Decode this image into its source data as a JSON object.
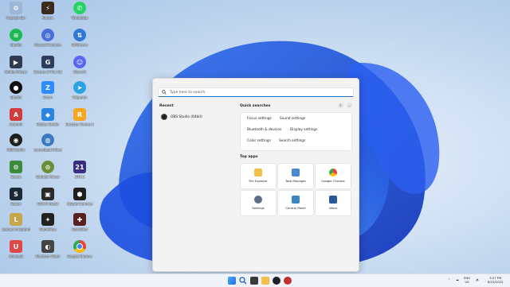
{
  "desktop": {
    "icons": [
      {
        "label": "Recycle Bin",
        "icon": "recycle-bin-icon",
        "color": "#9db6d6"
      },
      {
        "label": "Spotify",
        "icon": "spotify-icon",
        "color": "#1db954"
      },
      {
        "label": "Golden Player",
        "icon": "golden-player-icon",
        "color": "#2f3b4f"
      },
      {
        "label": "Spotify",
        "icon": "spotify-icon",
        "color": "#1db954"
      },
      {
        "label": "Android",
        "icon": "android-icon",
        "color": "#d13c3c"
      },
      {
        "label": "OBS Studio",
        "icon": "obs-icon",
        "color": "#1e1e1e"
      },
      {
        "label": "Steam",
        "icon": "steam-icon",
        "color": "#1b2838"
      },
      {
        "label": "Steam",
        "icon": "steam-icon",
        "color": "#1b2838"
      },
      {
        "label": "League of Legends",
        "icon": "lol-icon",
        "color": "#c8a64b"
      },
      {
        "label": "Uninstall",
        "icon": "uninstall-icon",
        "color": "#e04848"
      },
      {
        "label": "Kinetic",
        "icon": "kinetic-icon",
        "color": "#3b2b1e"
      },
      {
        "label": "Discord Connect",
        "icon": "discord-connect-icon",
        "color": "#4a6fd8"
      },
      {
        "label": "Garena of The Gamer",
        "icon": "garena-icon",
        "color": "#2e3d5c"
      },
      {
        "label": "Zoom",
        "icon": "zoom-icon",
        "color": "#2d8cff"
      },
      {
        "label": "Roblox Studio",
        "icon": "roblox-studio-icon",
        "color": "#2a86e0"
      },
      {
        "label": "Launchpad (Tiles)",
        "icon": "launchpad-icon",
        "color": "#3c7bbf"
      },
      {
        "label": "Outlook Mover",
        "icon": "outlook-mover-icon",
        "color": "#6b8f3a"
      },
      {
        "label": "GTA IV Install",
        "icon": "gta-icon",
        "color": "#2a2a2a"
      },
      {
        "label": "GamePrep",
        "icon": "gameprep-icon",
        "color": "#222222"
      },
      {
        "label": "Rockstar Client",
        "icon": "rockstar-icon",
        "color": "#444444"
      },
      {
        "label": "WhatsApp",
        "icon": "whatsapp-icon",
        "color": "#25d366"
      },
      {
        "label": "BitTorrent",
        "icon": "bittorrent-icon",
        "color": "#2f77d1"
      },
      {
        "label": "Discord",
        "icon": "discord-icon",
        "color": "#5865f2"
      },
      {
        "label": "Telegram",
        "icon": "telegram-icon",
        "color": "#2aa3e0"
      },
      {
        "label": "Rockstar Games Launcher",
        "icon": "rockstar-games-icon",
        "color": "#f5a623"
      },
      {
        "label": "GTA 5",
        "icon": "gta5-icon",
        "color": "#3b2d82"
      },
      {
        "label": "Ubisoft Connect",
        "icon": "ubisoft-icon",
        "color": "#1f1f1f"
      },
      {
        "label": "GameTest",
        "icon": "gametest-icon",
        "color": "#5a1f1f"
      },
      {
        "label": "Google Chrome",
        "icon": "chrome-icon",
        "color": "#fbbc05"
      }
    ]
  },
  "search": {
    "placeholder": "Type here to search"
  },
  "recent": {
    "heading": "Recent",
    "items": [
      {
        "label": "OBS Studio (64bit)",
        "icon": "obs-icon"
      }
    ]
  },
  "quick_searches": {
    "heading": "Quick searches",
    "items": [
      "Focus settings",
      "Sound settings",
      "Bluetooth & devices",
      "Display settings",
      "Color settings",
      "Search settings"
    ],
    "buttons": [
      "F",
      "..."
    ]
  },
  "top_apps": {
    "heading": "Top apps",
    "items": [
      {
        "label": "File Explorer",
        "icon": "folder-icon",
        "color": "#f2c04a"
      },
      {
        "label": "Task Manager",
        "icon": "task-manager-icon",
        "color": "#4a8ad1"
      },
      {
        "label": "Google Chrome",
        "icon": "chrome-icon",
        "color": "#e84335"
      },
      {
        "label": "Settings",
        "icon": "gear-icon",
        "color": "#5a6f8a"
      },
      {
        "label": "Control Panel",
        "icon": "control-panel-icon",
        "color": "#3d86c6"
      },
      {
        "label": "Word",
        "icon": "word-icon",
        "color": "#2b579a"
      }
    ]
  },
  "taskbar": {
    "time": "3:27 PM",
    "date": "8/23/2022",
    "lang_top": "ENG",
    "lang_bottom": "US"
  }
}
